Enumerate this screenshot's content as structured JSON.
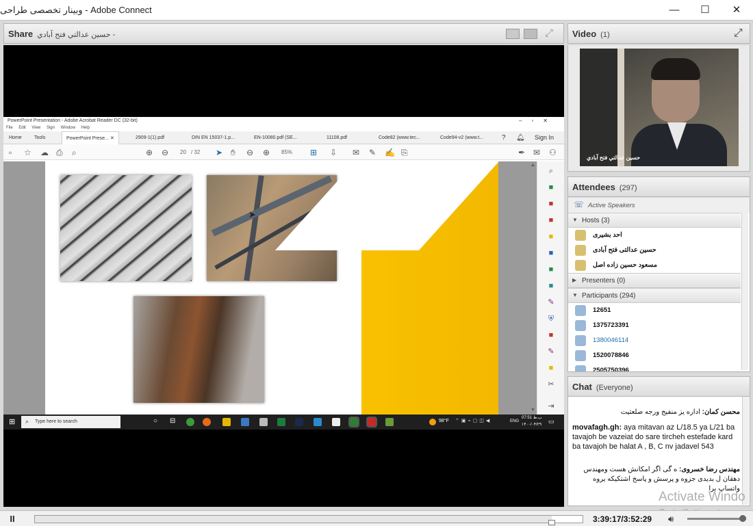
{
  "window": {
    "title": "وبینار تخصصی طراحی - Adobe Connect",
    "minimize": "—",
    "maximize": "☐",
    "close": "✕"
  },
  "share_pod": {
    "title": "Share",
    "presenter": "حسين عدالتي فتح آبادي -",
    "acrobat": {
      "title": "PowerPoint Presentation - Adobe Acrobat Reader DC (32-bit)",
      "menu": [
        "File",
        "Edit",
        "View",
        "Sign",
        "Window",
        "Help"
      ],
      "nav": [
        "Home",
        "Tools"
      ],
      "tabs": [
        "PowerPoint Prese...",
        "2909-1(1).pdf",
        "DIN EN 15037-1.p...",
        "EN-10080.pdf (SE...",
        "11108.pdf",
        "Code82 (www.tec...",
        "Code94-v2 (www.t..."
      ],
      "sign_in": "Sign In",
      "page_current": "20",
      "page_total": "/ 32",
      "zoom": "85%"
    },
    "taskbar": {
      "search_placeholder": "Type here to search",
      "temperature": "98°F",
      "lang": "ENG",
      "clock_time": "07:51 ب.ظ",
      "clock_date": "۱۴۰۰/۰۴/۲۹"
    }
  },
  "video_pod": {
    "title": "Video",
    "count": "(1)",
    "caption": "حسين عدالتي فتح آبادي"
  },
  "attendees_pod": {
    "title": "Attendees",
    "count": "(297)",
    "active_speakers": "Active Speakers",
    "hosts_label": "Hosts (3)",
    "hosts": [
      "احد بشیری",
      "حسین عدالتی فتح آبادی",
      "مسعود حسین زاده اصل"
    ],
    "presenters_label": "Presenters (0)",
    "participants_label": "Participants (294)",
    "participants": [
      "12651",
      "1375723391",
      "1380046114",
      "1520078846",
      "2505750396"
    ]
  },
  "chat_pod": {
    "title": "Chat",
    "scope": "(Everyone)",
    "messages": [
      {
        "author": "محسن کمان:",
        "text": "اداره یز منفیج ورجه صلعتیت"
      },
      {
        "author": "movafagh.gh:",
        "text": " aya mitavan az L/18.5 ya L/21 ba tavajoh be vazeiat do sare tircheh estefade kard ba tavajoh be halat A , B, C  nv jadavel 543"
      },
      {
        "author": "مهندس رضا خسروی:",
        "text": "ه گی اگر امکانش هست ومهندس دهقان ل بدیدی جزوه و پرسش و پاسخ اشتکیکه یروه واتساپ برا"
      }
    ]
  },
  "playback": {
    "pause_label": "II",
    "time": "3:39:17/3:52:29",
    "progress": 0.944,
    "volume": 0.95
  },
  "watermark": {
    "line1": "Activate Windo",
    "line2": "Go to Settings to ac"
  },
  "colors": {
    "accent_link": "#1a6fa8",
    "yellow": "#f8c100"
  }
}
